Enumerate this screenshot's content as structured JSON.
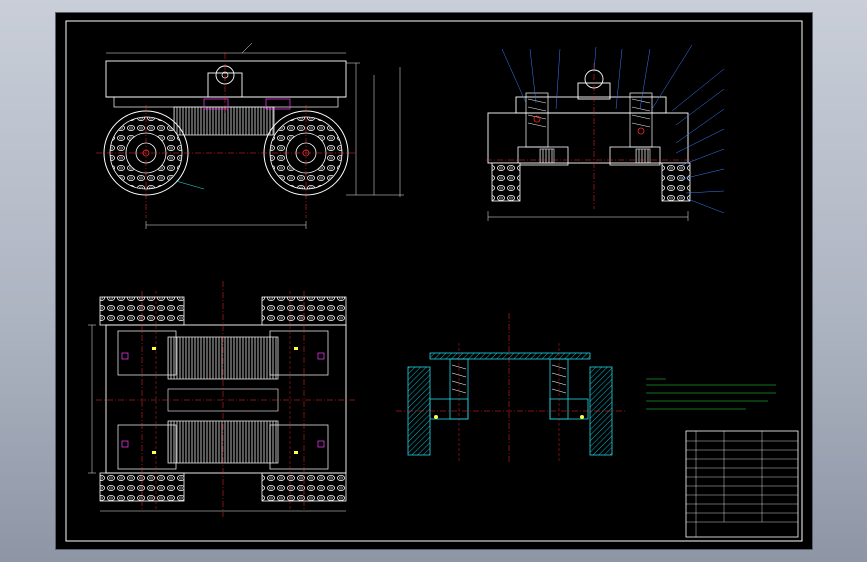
{
  "viewer": {
    "background": "#b8bec9",
    "sheet_color": "#000000"
  },
  "colors": {
    "outline": "#ffffff",
    "centerline": "#ff2a2a",
    "dimension": "#f0f0f0",
    "section_cyan": "#22d8e8",
    "hatch": "#00b7c8",
    "leader_blue": "#3a7bff",
    "note_green": "#22e23a",
    "magenta": "#ff3dff",
    "yellow": "#ffff40"
  },
  "icons": {
    "crosshair": "plus-marker-icon",
    "bearing": "circle-bearing-icon"
  },
  "title_block": {
    "rows": 11,
    "columns": 4
  }
}
